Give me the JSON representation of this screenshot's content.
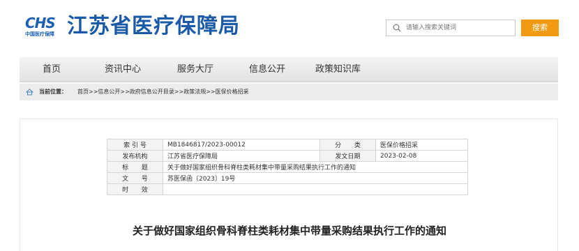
{
  "header": {
    "logo_mark": "CHS",
    "logo_sub": "中国医疗保障",
    "site_title": "江苏省医疗保障局",
    "search_placeholder": "请输入搜索关键词",
    "search_button": "搜索"
  },
  "nav": {
    "items": [
      "首页",
      "资讯中心",
      "服务大厅",
      "信息公开",
      "政策知识库"
    ]
  },
  "breadcrumb": {
    "label": "当前位置：",
    "path": "首页>>信息公开>>政府信息公开目录>>政策法规>>医保价格招采"
  },
  "meta": {
    "index_label": "索 引 号",
    "index_value": "MB1846817/2023-00012",
    "category_label": "分 类",
    "category_value": "医保价格招采",
    "publisher_label": "发布机构",
    "publisher_value": "江苏省医疗保障局",
    "date_label": "发文日期",
    "date_value": "2023-02-08",
    "title_label": "标 题",
    "title_value": "关于做好国家组织骨科脊柱类耗材集中带量采购结果执行工作的通知",
    "docno_label": "文 号",
    "docno_value": "苏医保函〔2023〕19号",
    "validity_label": "时 效",
    "validity_value": ""
  },
  "document": {
    "title": "关于做好国家组织骨科脊柱类耗材集中带量采购结果执行工作的通知"
  },
  "colors": {
    "brand_blue": "#1b5aa8",
    "search_orange": "#f19a12"
  }
}
